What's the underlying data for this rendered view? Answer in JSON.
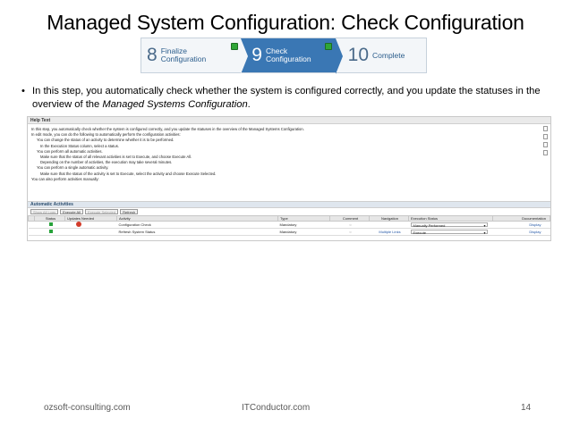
{
  "slide": {
    "title": "Managed System Configuration: Check Configuration",
    "bullet_prefix": "In this step, you automatically check whether the system is configured correctly, and you update the statuses in the overview of the ",
    "bullet_italic": "Managed Systems Configuration",
    "bullet_suffix": "."
  },
  "steps": [
    {
      "num": "8",
      "line1": "Finalize",
      "line2": "Configuration"
    },
    {
      "num": "9",
      "line1": "Check",
      "line2": "Configuration"
    },
    {
      "num": "10",
      "line1": "Complete",
      "line2": ""
    }
  ],
  "help": {
    "title": "Help Text",
    "lines": [
      "In this step, you automatically check whether the system is configured correctly, and you update the statuses in the overview of the Managed Systems Configuration.",
      "In edit mode, you can do the following to automatically perform the configuration activities:",
      "You can change the status of an activity to determine whether it is to be performed.",
      "In the Execution Status column, select a status.",
      "You can perform all automatic activities.",
      "Make sure that the status of all relevant activities is set to Execute, and choose Execute All.",
      "Depending on the number of activities, the execution may take several minutes.",
      "You can perform a single automatic activity.",
      "Make sure that the status of the activity is set to Execute, select the activity and choose Execute Selected.",
      "You can also perform activities manually:"
    ]
  },
  "activities": {
    "title": "Automatic Activities",
    "buttons": [
      "Show All Logs",
      "Execute All",
      "Execute Selected",
      "Refresh"
    ],
    "columns": [
      "Status",
      "Updates Needed",
      "Activity",
      "Type",
      "Comment",
      "Navigation",
      "Execution Status",
      "Documentation"
    ],
    "rows": [
      {
        "activity": "Configuration Check",
        "type": "Mandatory",
        "navigation": "",
        "exec_status": "Manually Performed",
        "doc": "Display"
      },
      {
        "activity": "Refresh System Status",
        "type": "Mandatory",
        "navigation": "Multiple Links",
        "exec_status": "Execute",
        "doc": "Display"
      }
    ]
  },
  "footer": {
    "left": "ozsoft-consulting.com",
    "center": "ITConductor.com",
    "page": "14"
  },
  "colors": {
    "active_step": "#3a77b4",
    "check_green": "#2fa637"
  }
}
